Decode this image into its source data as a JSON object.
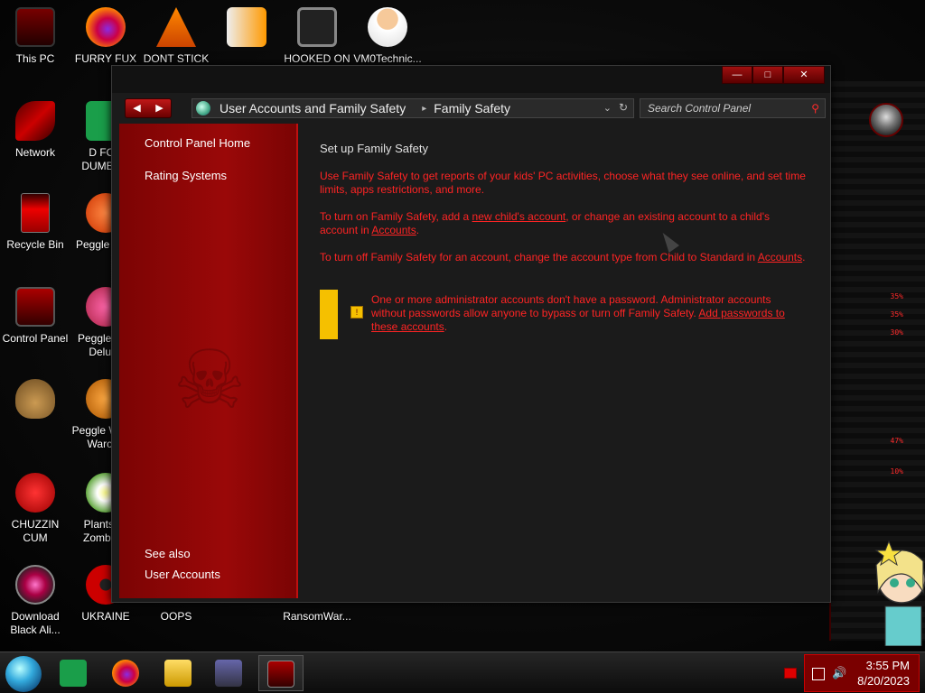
{
  "desktop": {
    "icons": [
      {
        "label": "This PC"
      },
      {
        "label": "FURRY FUX"
      },
      {
        "label": "DONT STICK THIS IN YO..."
      },
      {
        "label": ""
      },
      {
        "label": "HOOKED ON XONIX"
      },
      {
        "label": "VM0Technic..."
      },
      {
        "label": "Network"
      },
      {
        "label": "D FOR DUMBA..."
      },
      {
        "label": "Recycle Bin"
      },
      {
        "label": "Peggle De..."
      },
      {
        "label": "Control Panel"
      },
      {
        "label": "Peggle Ni... Deluxe"
      },
      {
        "label": ""
      },
      {
        "label": "Peggle W... of Warcr..."
      },
      {
        "label": "CHUZZIN CUM"
      },
      {
        "label": "Plants vs Zombie..."
      },
      {
        "label": "Download Black Ali..."
      },
      {
        "label": "UKRAINE"
      },
      {
        "label": "OOPS"
      },
      {
        "label": ""
      },
      {
        "label": "RansomWar..."
      }
    ],
    "side_stats": [
      "35%",
      "35%",
      "30%",
      "47%",
      "10%"
    ]
  },
  "window": {
    "controls": {
      "minimize": "—",
      "maximize": "□",
      "close": "✕"
    },
    "nav": {
      "back": "◀",
      "forward": "▶"
    },
    "address": {
      "crumbs": [
        "User Accounts and Family Safety",
        "Family Safety"
      ],
      "separator": "▸",
      "dropdown": "⌄",
      "refresh": "↻"
    },
    "search": {
      "placeholder": "Search Control Panel",
      "icon": "search-icon"
    },
    "sidebar": {
      "home": "Control Panel Home",
      "rating": "Rating Systems",
      "see_also": "See also",
      "user_accounts": "User Accounts"
    },
    "content": {
      "heading": "Set up Family Safety",
      "p1": "Use Family Safety to get reports of your kids' PC activities, choose what they see online, and set time limits, apps restrictions, and more.",
      "p2_a": "To turn on Family Safety, add a ",
      "p2_link1": "new child's account",
      "p2_b": ", or change an existing account to a child's account in ",
      "p2_link2": "Accounts",
      "p2_c": ".",
      "p3_a": "To turn off Family Safety for an account, change the account type from Child to Standard in ",
      "p3_link": "Accounts",
      "p3_b": ".",
      "warning_text": "One or more administrator accounts don't have a password. Administrator accounts without passwords allow anyone to bypass or turn off Family Safety. ",
      "warning_link": "Add passwords to these accounts",
      "warning_end": "."
    }
  },
  "taskbar": {
    "time": "3:55 PM",
    "date": "8/20/2023"
  },
  "colors": {
    "accent_red": "#ff2424",
    "sidebar_red": "#9a0808",
    "warning_yellow": "#f5c000"
  }
}
